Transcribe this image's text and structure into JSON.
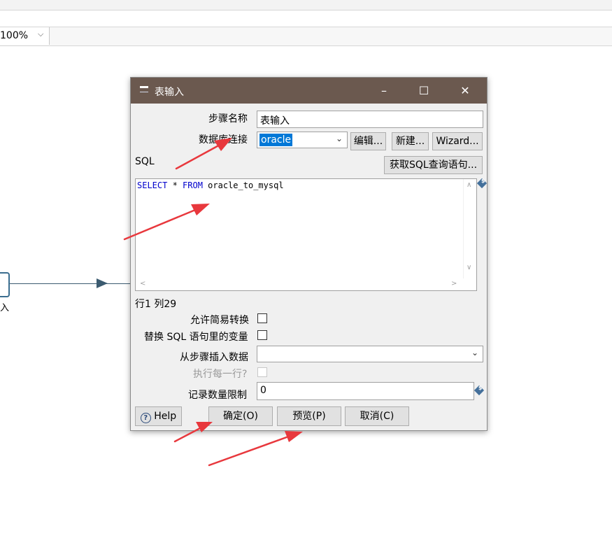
{
  "toolbar": {
    "zoom_value": "100%"
  },
  "canvas": {
    "node_label": "入"
  },
  "dialog": {
    "title": "表输入",
    "step_name_label": "步骤名称",
    "step_name_value": "表输入",
    "db_connection_label": "数据库连接",
    "db_connection_value": "oracle",
    "edit_button": "编辑...",
    "new_button": "新建...",
    "wizard_button": "Wizard...",
    "sql_label": "SQL",
    "get_sql_button": "获取SQL查询语句...",
    "sql": {
      "kw1": "SELECT",
      "op": " * ",
      "kw2": "FROM",
      "rest": " oracle_to_mysql"
    },
    "cursor_status": "行1 列29",
    "lazy_conversion_label": "允许简易转换",
    "replace_vars_label": "替换 SQL 语句里的变量",
    "insert_from_step_label": "从步骤插入数据",
    "execute_each_row_label": "执行每一行?",
    "limit_label": "记录数量限制",
    "limit_value": "0",
    "help_button": "Help",
    "ok_button": "确定(O)",
    "preview_button": "预览(P)",
    "cancel_button": "取消(C)"
  },
  "colors": {
    "titlebar": "#6b594f",
    "arrow": "#e8383d",
    "selection": "#0078d7"
  }
}
